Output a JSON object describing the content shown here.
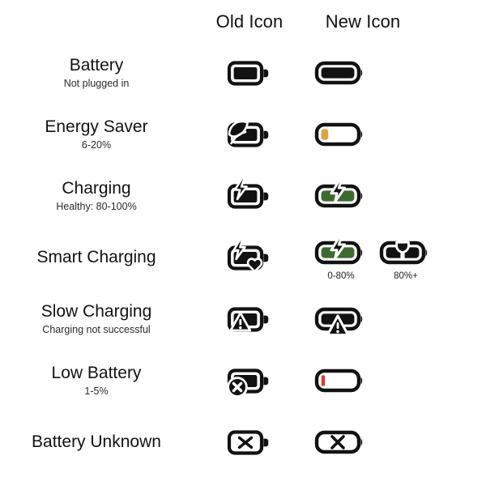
{
  "page": {
    "background": "#ffffff",
    "text_color": "#121212"
  },
  "header": {
    "old_label": "Old Icon",
    "new_label": "New Icon"
  },
  "colors": {
    "outline": "#121212",
    "green": "#3d6b2e",
    "amber": "#e0a33e",
    "red": "#d93a33",
    "white": "#ffffff"
  },
  "rows": [
    {
      "title": "Battery",
      "sub": "Not plugged in",
      "old_icon": "battery-full-old-icon",
      "new_icons": [
        {
          "icon": "battery-full-new-icon",
          "caption": ""
        }
      ]
    },
    {
      "title": "Energy Saver",
      "sub": "6-20%",
      "old_icon": "battery-leaf-old-icon",
      "new_icons": [
        {
          "icon": "battery-energy-saver-new-icon",
          "caption": ""
        }
      ]
    },
    {
      "title": "Charging",
      "sub": "Healthy: 80-100%",
      "old_icon": "battery-charging-old-icon",
      "new_icons": [
        {
          "icon": "battery-charging-new-icon",
          "caption": ""
        }
      ]
    },
    {
      "title": "Smart Charging",
      "sub": "",
      "old_icon": "battery-smart-charging-old-icon",
      "new_icons": [
        {
          "icon": "battery-smart-charging-bolt-new-icon",
          "caption": "0-80%"
        },
        {
          "icon": "battery-smart-charging-plug-new-icon",
          "caption": "80%+"
        }
      ]
    },
    {
      "title": "Slow Charging",
      "sub": "Charging not successful",
      "old_icon": "battery-slow-charging-old-icon",
      "new_icons": [
        {
          "icon": "battery-slow-charging-new-icon",
          "caption": ""
        }
      ]
    },
    {
      "title": "Low Battery",
      "sub": "1-5%",
      "old_icon": "battery-low-old-icon",
      "new_icons": [
        {
          "icon": "battery-low-new-icon",
          "caption": ""
        }
      ]
    },
    {
      "title": "Battery Unknown",
      "sub": "",
      "old_icon": "battery-unknown-old-icon",
      "new_icons": [
        {
          "icon": "battery-unknown-new-icon",
          "caption": ""
        }
      ]
    }
  ]
}
